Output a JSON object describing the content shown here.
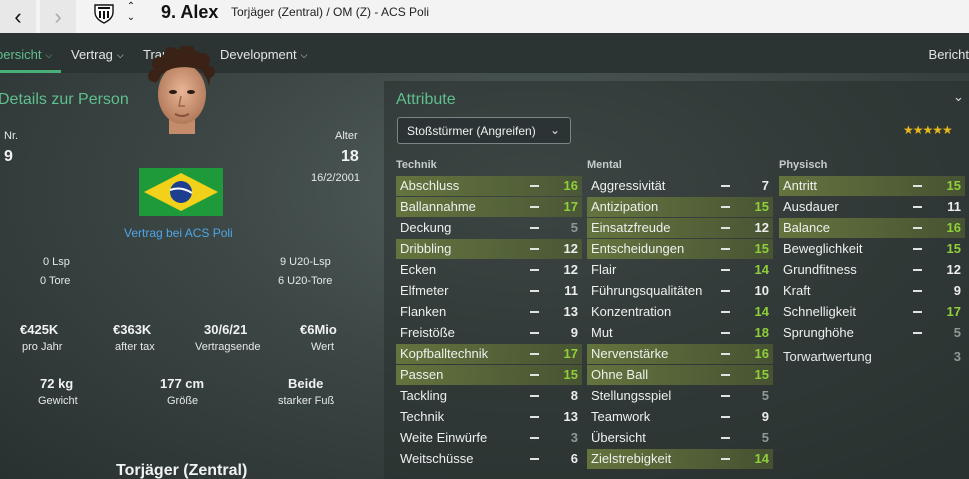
{
  "titlebar": {
    "title": "9. Alex",
    "subtitle": "Torjäger (Zentral) / OM (Z) - ACS Poli"
  },
  "icons": {
    "back": "‹",
    "forward": "›",
    "up": "⌃",
    "down": "⌄"
  },
  "menu": {
    "items": [
      {
        "label": "bersicht",
        "active": true
      },
      {
        "label": "Vertrag"
      },
      {
        "label": "Transfer"
      },
      {
        "label": "Development"
      }
    ],
    "right": "Bericht"
  },
  "person": {
    "section_title": "Details zur Person",
    "number_label": "Nr.",
    "number": "9",
    "age_label": "Alter",
    "age": "18",
    "dob": "16/2/2001",
    "contract_text": "Vertrag bei ACS Poli",
    "caps": "0 Lsp",
    "goals": "0 Tore",
    "u20_caps": "9 U20-Lsp",
    "u20_goals": "6 U20-Tore",
    "stats": [
      {
        "value": "€425K",
        "label": "pro Jahr"
      },
      {
        "value": "€363K",
        "label": "after tax"
      },
      {
        "value": "30/6/21",
        "label": "Vertragsende"
      },
      {
        "value": "€6Mio",
        "label": "Wert"
      }
    ],
    "body": [
      {
        "value": "72 kg",
        "label": "Gewicht"
      },
      {
        "value": "177 cm",
        "label": "Größe"
      },
      {
        "value": "Beide",
        "label": "starker Fuß"
      }
    ],
    "role_heading": "Torjäger (Zentral)"
  },
  "attributes": {
    "section_title": "Attribute",
    "role_select": "Stoßstürmer (Angreifen)",
    "stars": "★★★★★",
    "star_rating": 4.5,
    "columns": [
      {
        "heading": "Technik",
        "rows": [
          {
            "name": "Abschluss",
            "value": "16",
            "hl": true
          },
          {
            "name": "Ballannahme",
            "value": "17",
            "hl": true
          },
          {
            "name": "Deckung",
            "value": "5",
            "hl": false
          },
          {
            "name": "Dribbling",
            "value": "12",
            "hl": true
          },
          {
            "name": "Ecken",
            "value": "12",
            "hl": false
          },
          {
            "name": "Elfmeter",
            "value": "11",
            "hl": false
          },
          {
            "name": "Flanken",
            "value": "13",
            "hl": false
          },
          {
            "name": "Freistöße",
            "value": "9",
            "hl": false
          },
          {
            "name": "Kopfballtechnik",
            "value": "17",
            "hl": true
          },
          {
            "name": "Passen",
            "value": "15",
            "hl": true
          },
          {
            "name": "Tackling",
            "value": "8",
            "hl": false
          },
          {
            "name": "Technik",
            "value": "13",
            "hl": false
          },
          {
            "name": "Weite Einwürfe",
            "value": "3",
            "hl": false
          },
          {
            "name": "Weitschüsse",
            "value": "6",
            "hl": false
          }
        ]
      },
      {
        "heading": "Mental",
        "rows": [
          {
            "name": "Aggressivität",
            "value": "7",
            "hl": false
          },
          {
            "name": "Antizipation",
            "value": "15",
            "hl": true
          },
          {
            "name": "Einsatzfreude",
            "value": "12",
            "hl": true
          },
          {
            "name": "Entscheidungen",
            "value": "15",
            "hl": true
          },
          {
            "name": "Flair",
            "value": "14",
            "hl": false
          },
          {
            "name": "Führungsqualitäten",
            "value": "10",
            "hl": false
          },
          {
            "name": "Konzentration",
            "value": "14",
            "hl": false
          },
          {
            "name": "Mut",
            "value": "18",
            "hl": false
          },
          {
            "name": "Nervenstärke",
            "value": "16",
            "hl": true
          },
          {
            "name": "Ohne Ball",
            "value": "15",
            "hl": true
          },
          {
            "name": "Stellungsspiel",
            "value": "5",
            "hl": false
          },
          {
            "name": "Teamwork",
            "value": "9",
            "hl": false
          },
          {
            "name": "Übersicht",
            "value": "5",
            "hl": false
          },
          {
            "name": "Zielstrebigkeit",
            "value": "14",
            "hl": true
          }
        ]
      },
      {
        "heading": "Physisch",
        "rows": [
          {
            "name": "Antritt",
            "value": "15",
            "hl": true
          },
          {
            "name": "Ausdauer",
            "value": "11",
            "hl": false
          },
          {
            "name": "Balance",
            "value": "16",
            "hl": true
          },
          {
            "name": "Beweglichkeit",
            "value": "15",
            "hl": false
          },
          {
            "name": "Grundfitness",
            "value": "12",
            "hl": false
          },
          {
            "name": "Kraft",
            "value": "9",
            "hl": false
          },
          {
            "name": "Schnelligkeit",
            "value": "17",
            "hl": false
          },
          {
            "name": "Sprunghöhe",
            "value": "5",
            "hl": false
          }
        ]
      }
    ],
    "gk_label": "Torwartwertung",
    "gk_value": "3"
  },
  "colors": {
    "accent": "#5fbf8e",
    "link": "#4fa6e6",
    "value_low": "#8f9896",
    "value_mid": "#eceeed",
    "value_high": "#8fcf3a",
    "star": "#e8b81a"
  }
}
